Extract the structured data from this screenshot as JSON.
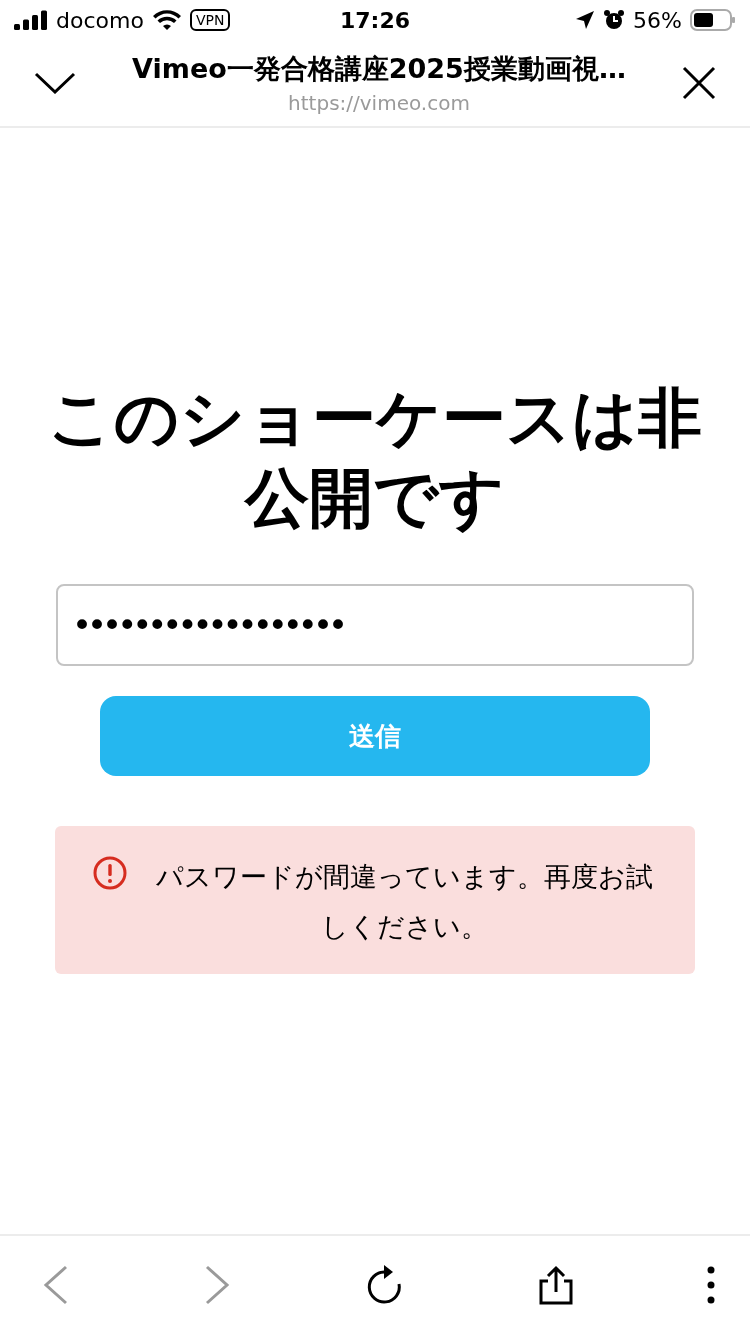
{
  "status_bar": {
    "carrier": "docomo",
    "vpn": "VPN",
    "time": "17:26",
    "battery": "56%"
  },
  "browser_header": {
    "title": "Vimeo一発合格講座2025授業動画視…",
    "url": "https://vimeo.com"
  },
  "heading": "このショーケースは非公開です",
  "password_field": {
    "value": "••••••••••••••••••"
  },
  "submit_button": "送信",
  "error": {
    "message": "パスワードが間違っています。再度お試しください。"
  },
  "toolbar": [
    {
      "kind": "back",
      "disabled": true
    },
    {
      "kind": "forward",
      "disabled": true
    },
    {
      "kind": "reload",
      "disabled": false
    },
    {
      "kind": "share",
      "disabled": false
    },
    {
      "kind": "more",
      "disabled": false
    }
  ]
}
